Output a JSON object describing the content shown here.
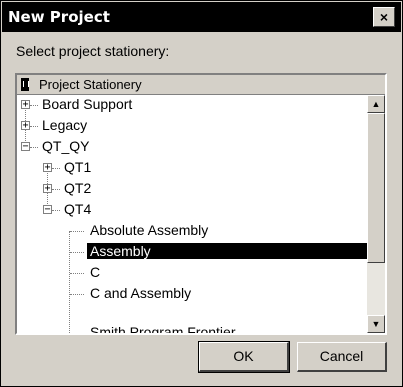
{
  "window": {
    "title": "New Project",
    "close_symbol": "×"
  },
  "prompt": "Select project stationery:",
  "list": {
    "header": "Project Stationery",
    "items": [
      {
        "label": "Board Support",
        "expander": "+"
      },
      {
        "label": "Legacy",
        "expander": "+"
      },
      {
        "label": "QT_QY",
        "expander": "−"
      },
      {
        "label": "QT1",
        "expander": "+"
      },
      {
        "label": "QT2",
        "expander": "+"
      },
      {
        "label": "QT4",
        "expander": "−"
      },
      {
        "label": "Absolute Assembly"
      },
      {
        "label": "Assembly",
        "selected": true
      },
      {
        "label": "C"
      },
      {
        "label": "C and Assembly"
      },
      {
        "label": "Smith Program Frontier"
      }
    ]
  },
  "scrollbar": {
    "up": "▲",
    "down": "▼"
  },
  "buttons": {
    "ok": "OK",
    "cancel": "Cancel"
  }
}
